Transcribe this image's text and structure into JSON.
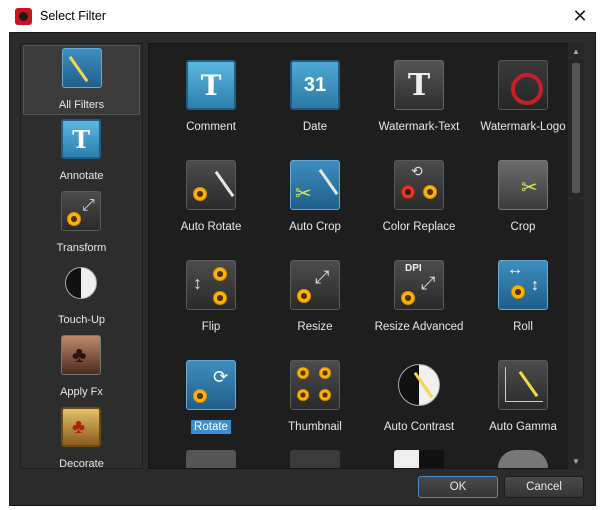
{
  "window": {
    "title": "Select Filter",
    "close_glyph": "✕"
  },
  "categories": [
    {
      "label": "All Filters",
      "icon": "all-filters-icon",
      "selected": true
    },
    {
      "label": "Annotate",
      "icon": "annotate-icon",
      "selected": false
    },
    {
      "label": "Transform",
      "icon": "transform-icon",
      "selected": false
    },
    {
      "label": "Touch-Up",
      "icon": "touch-up-icon",
      "selected": false
    },
    {
      "label": "Apply Fx",
      "icon": "apply-fx-icon",
      "selected": false
    },
    {
      "label": "Decorate",
      "icon": "decorate-icon",
      "selected": false
    }
  ],
  "filters": [
    {
      "label": "Comment",
      "icon": "comment-icon",
      "glyph": "T"
    },
    {
      "label": "Date",
      "icon": "date-icon",
      "glyph": "31"
    },
    {
      "label": "Watermark-Text",
      "icon": "watermark-text-icon",
      "glyph": "T"
    },
    {
      "label": "Watermark-Logo",
      "icon": "watermark-logo-icon"
    },
    {
      "label": "Auto Rotate",
      "icon": "auto-rotate-icon"
    },
    {
      "label": "Auto Crop",
      "icon": "auto-crop-icon"
    },
    {
      "label": "Color Replace",
      "icon": "color-replace-icon"
    },
    {
      "label": "Crop",
      "icon": "crop-icon"
    },
    {
      "label": "Flip",
      "icon": "flip-icon"
    },
    {
      "label": "Resize",
      "icon": "resize-icon"
    },
    {
      "label": "Resize Advanced",
      "icon": "resize-advanced-icon",
      "glyph": "DPI"
    },
    {
      "label": "Roll",
      "icon": "roll-icon"
    },
    {
      "label": "Rotate",
      "icon": "rotate-icon",
      "selected": true
    },
    {
      "label": "Thumbnail",
      "icon": "thumbnail-icon"
    },
    {
      "label": "Auto Contrast",
      "icon": "auto-contrast-icon"
    },
    {
      "label": "Auto Gamma",
      "icon": "auto-gamma-icon"
    }
  ],
  "scrollbar": {
    "up_glyph": "▲",
    "down_glyph": "▼"
  },
  "buttons": {
    "ok": "OK",
    "cancel": "Cancel"
  },
  "colors": {
    "selection": "#3a8fd2",
    "pane_bg": "#1e1e1e",
    "dialog_bg": "#2b2b2b"
  }
}
